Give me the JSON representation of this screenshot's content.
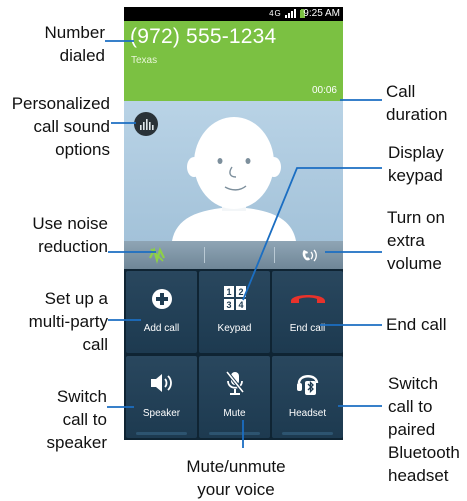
{
  "status": {
    "time": "9:25 AM",
    "network": "4G"
  },
  "call": {
    "number": "(972) 555-1234",
    "location": "Texas",
    "duration": "00:06"
  },
  "buttons": {
    "add_call": "Add call",
    "keypad": "Keypad",
    "end_call": "End call",
    "speaker": "Speaker",
    "mute": "Mute",
    "headset": "Headset"
  },
  "annotations": {
    "number_dialed": [
      "Number",
      "dialed"
    ],
    "call_duration": [
      "Call",
      "duration"
    ],
    "sound_options": [
      "Personalized",
      "call sound",
      "options"
    ],
    "display_keypad": [
      "Display",
      "keypad"
    ],
    "noise_reduction": [
      "Use noise",
      "reduction"
    ],
    "extra_volume": [
      "Turn on",
      "extra",
      "volume"
    ],
    "multi_party": [
      "Set up a",
      "multi-party",
      "call"
    ],
    "end_call": [
      "End call"
    ],
    "switch_speaker": [
      "Switch",
      "call to",
      "speaker"
    ],
    "mute_voice": [
      "Mute/unmute",
      "your voice"
    ],
    "bluetooth": [
      "Switch",
      "call to",
      "paired",
      "Bluetooth",
      "headset"
    ]
  },
  "colors": {
    "header_green": "#7bc142",
    "end_call_red": "#e8322b",
    "noise_icon_green": "#8ed046",
    "tile_blue": "#223f55"
  }
}
